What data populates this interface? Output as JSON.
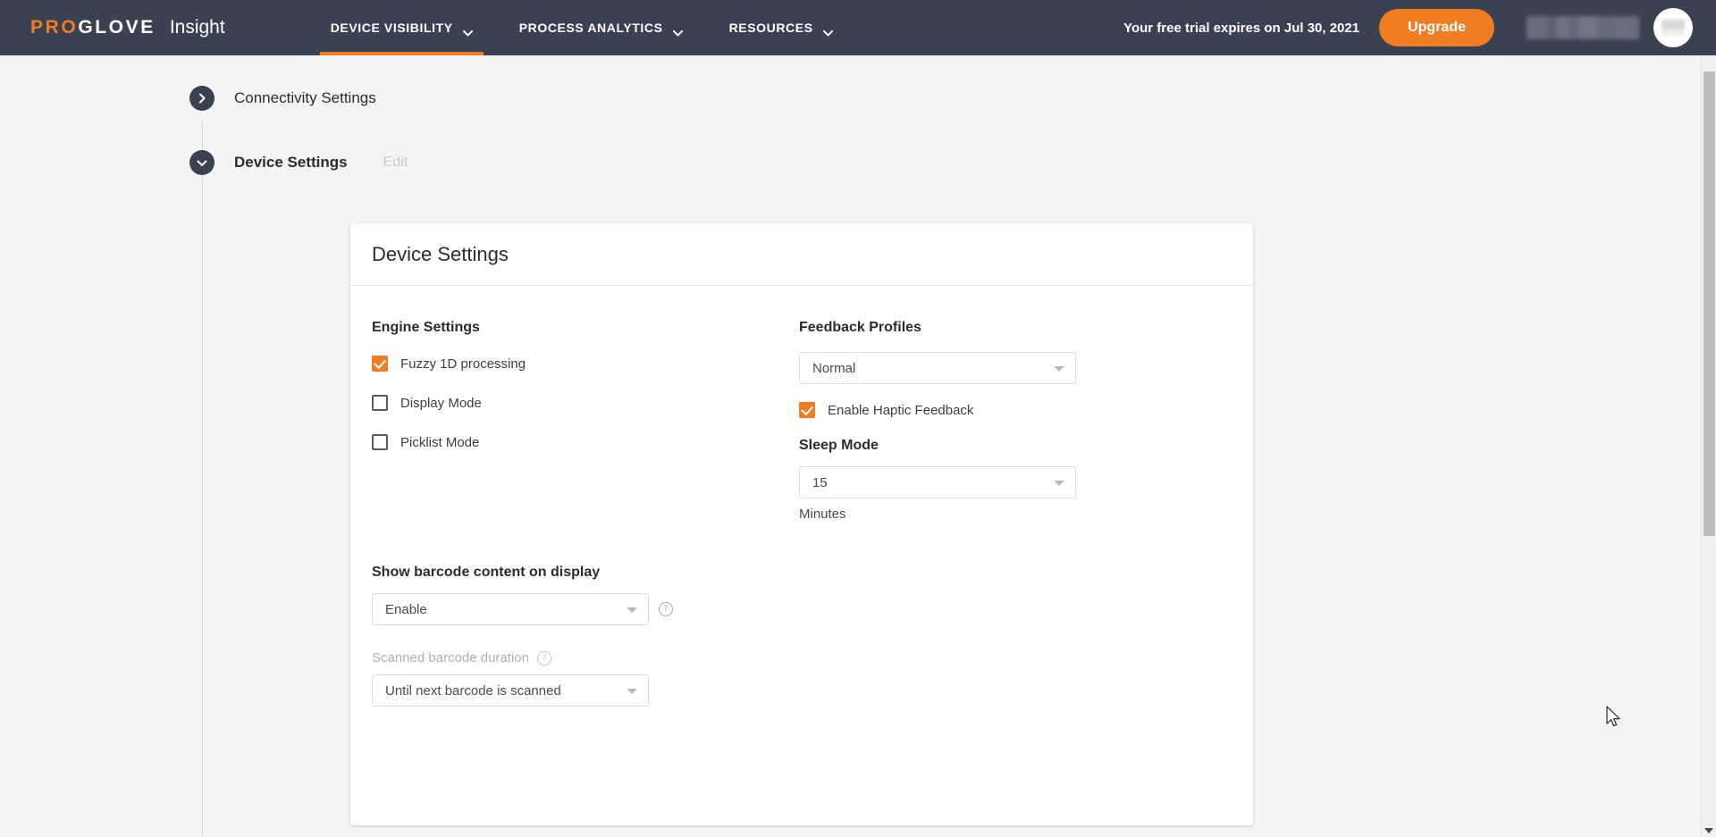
{
  "header": {
    "brand_pro": "PRO",
    "brand_glove": "GLOVE",
    "product": "Insight",
    "nav": [
      {
        "label": "DEVICE VISIBILITY",
        "icon": "chevron-down-icon",
        "active": true
      },
      {
        "label": "PROCESS ANALYTICS",
        "icon": "chevron-down-icon",
        "active": false
      },
      {
        "label": "RESOURCES",
        "icon": "chevron-down-icon",
        "active": false
      }
    ],
    "trial_notice": "Your free trial expires on Jul 30, 2021",
    "upgrade_label": "Upgrade",
    "accent_color": "#f07d22",
    "bar_color": "#3a4150"
  },
  "timeline": [
    {
      "label": "Connectivity Settings",
      "icon": "chevron-right-icon",
      "expanded": false
    },
    {
      "label": "Device Settings",
      "icon": "chevron-down-icon",
      "expanded": true,
      "edit_label": "Edit"
    }
  ],
  "card": {
    "title": "Device Settings",
    "engine": {
      "title": "Engine Settings",
      "checkboxes": [
        {
          "label": "Fuzzy 1D processing",
          "checked": true
        },
        {
          "label": "Display Mode",
          "checked": false
        },
        {
          "label": "Picklist Mode",
          "checked": false
        }
      ]
    },
    "feedback": {
      "title": "Feedback Profiles",
      "profile_value": "Normal",
      "haptic_label": "Enable Haptic Feedback",
      "haptic_checked": true
    },
    "sleep": {
      "title": "Sleep Mode",
      "value": "15",
      "unit": "Minutes"
    },
    "barcode_display": {
      "title": "Show barcode content on display",
      "value": "Enable",
      "help_icon": "question-mark-icon"
    },
    "scanned_duration": {
      "label": "Scanned barcode duration",
      "value": "Until next barcode is scanned",
      "help_icon": "question-mark-icon"
    }
  }
}
